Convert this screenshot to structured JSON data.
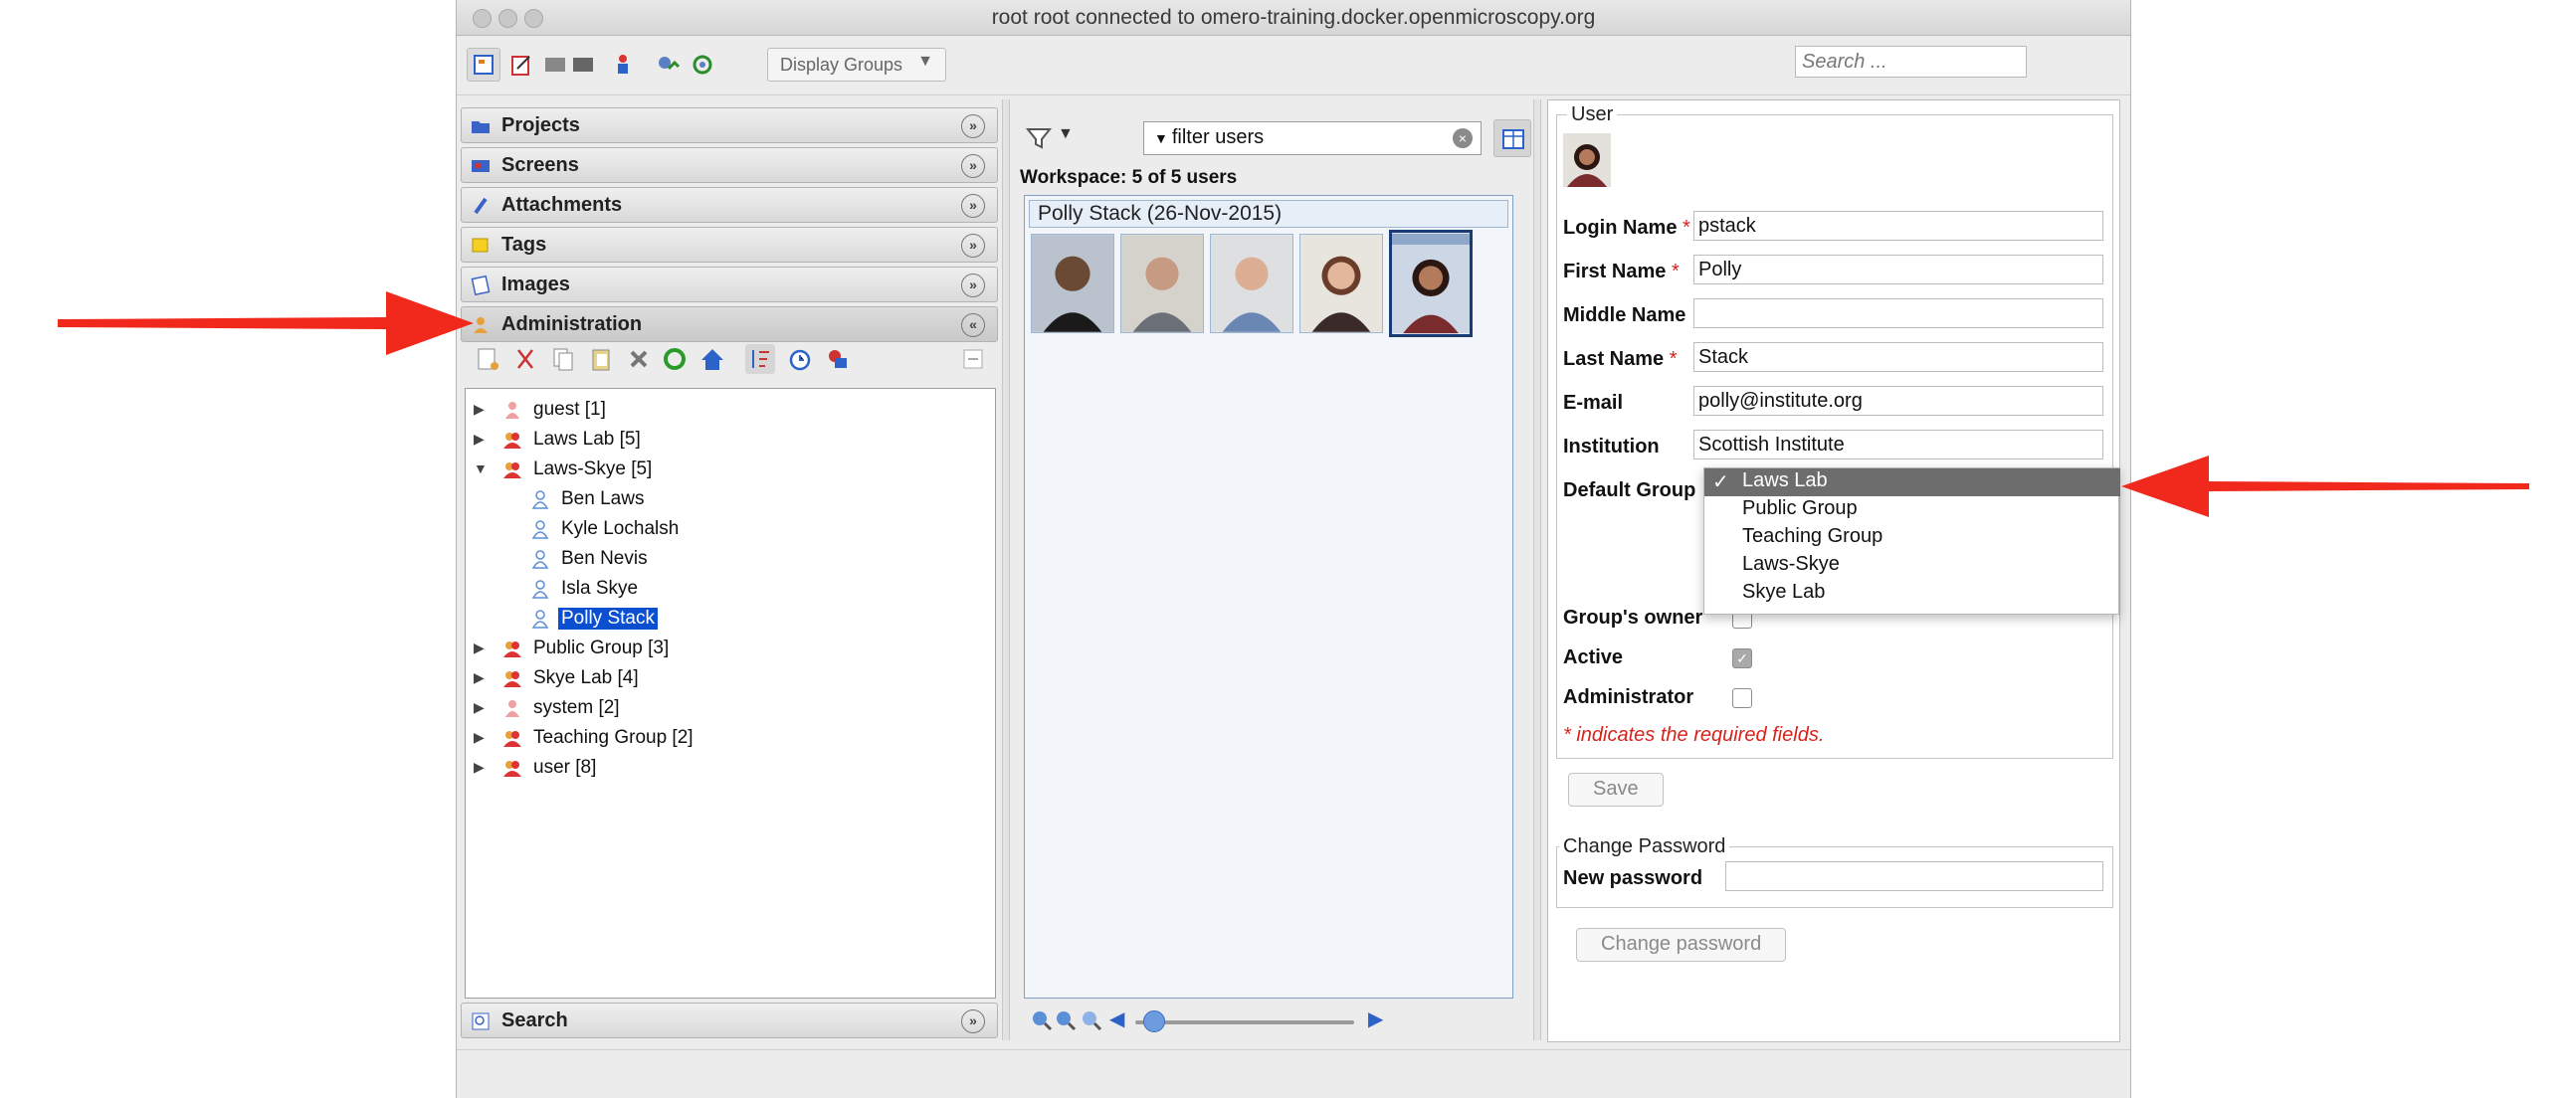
{
  "window": {
    "title": "root root connected to omero-training.docker.openmicroscopy.org"
  },
  "toolbar": {
    "display_groups_label": "Display Groups",
    "search_placeholder": "Search ..."
  },
  "left": {
    "accordion": [
      {
        "label": "Projects",
        "icon": "folder-icon"
      },
      {
        "label": "Screens",
        "icon": "screen-icon"
      },
      {
        "label": "Attachments",
        "icon": "paperclip-icon"
      },
      {
        "label": "Tags",
        "icon": "tag-icon"
      },
      {
        "label": "Images",
        "icon": "image-icon"
      },
      {
        "label": "Administration",
        "icon": "users-icon"
      }
    ],
    "search_label": "Search",
    "tree": [
      {
        "label": "guest [1]",
        "kind": "group",
        "expanded": false
      },
      {
        "label": "Laws Lab [5]",
        "kind": "group",
        "expanded": false
      },
      {
        "label": "Laws-Skye [5]",
        "kind": "group",
        "expanded": true
      },
      {
        "label": "Ben Laws",
        "kind": "user"
      },
      {
        "label": "Kyle Lochalsh",
        "kind": "user"
      },
      {
        "label": "Ben Nevis",
        "kind": "user"
      },
      {
        "label": "Isla Skye",
        "kind": "user"
      },
      {
        "label": "Polly Stack",
        "kind": "user",
        "selected": true
      },
      {
        "label": "Public Group [3]",
        "kind": "group",
        "expanded": false
      },
      {
        "label": "Skye Lab [4]",
        "kind": "group",
        "expanded": false
      },
      {
        "label": "system [2]",
        "kind": "group",
        "expanded": false
      },
      {
        "label": "Teaching Group [2]",
        "kind": "group",
        "expanded": false
      },
      {
        "label": "user [8]",
        "kind": "group",
        "expanded": false
      }
    ]
  },
  "middle": {
    "filter_value": "filter users",
    "workspace_label": "Workspace: 5 of 5 users",
    "group_header": "Polly Stack (26-Nov-2015)",
    "thumbnail_count": 5
  },
  "user_form": {
    "legend": "User",
    "fields": {
      "login_name": {
        "label": "Login Name",
        "value": "pstack"
      },
      "first_name": {
        "label": "First Name",
        "value": "Polly"
      },
      "middle_name": {
        "label": "Middle Name",
        "value": ""
      },
      "last_name": {
        "label": "Last Name",
        "value": "Stack"
      },
      "email": {
        "label": "E-mail",
        "value": "polly@institute.org"
      },
      "institution": {
        "label": "Institution",
        "value": "Scottish Institute"
      }
    },
    "default_group_label": "Default Group",
    "default_group_options": [
      "Laws Lab",
      "Public Group",
      "Teaching Group",
      "Laws-Skye",
      "Skye Lab"
    ],
    "default_group_selected": "Laws Lab",
    "groups_owner_label": "Group's owner",
    "active_label": "Active",
    "admin_label": "Administrator",
    "required_note": "* indicates the required fields.",
    "required_mark": "*",
    "check_mark": "✓",
    "save_label": "Save"
  },
  "password": {
    "legend": "Change Password",
    "new_password_label": "New password",
    "button_label": "Change password"
  },
  "colors": {
    "selection": "#0b4fd1",
    "required": "#d6231c",
    "annotation_arrow": "#f0291c"
  }
}
